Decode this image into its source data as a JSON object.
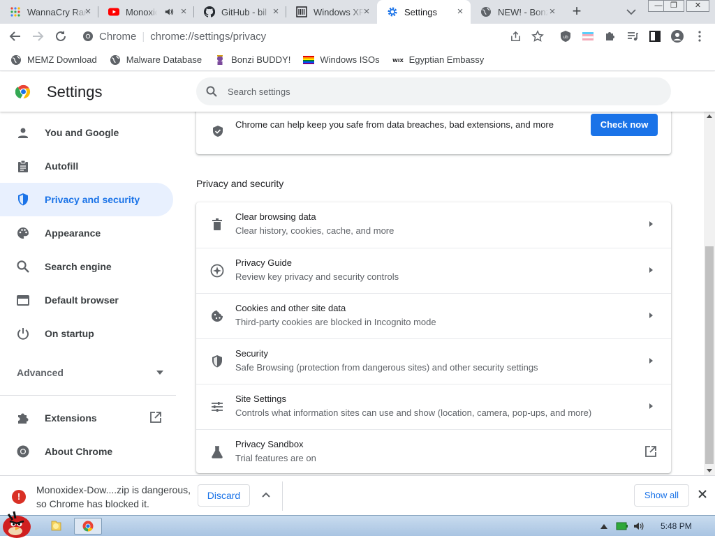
{
  "tabs": [
    {
      "title": "WannaCry Ransomware - Google Search",
      "icon": "google-apps-icon",
      "close": "×"
    },
    {
      "title": "Monoxidex - YouTube",
      "icon": "youtube-icon",
      "close": "×",
      "audio": "speaker-icon"
    },
    {
      "title": "GitHub - bil",
      "icon": "github-icon",
      "close": "×"
    },
    {
      "title": "Windows XP",
      "icon": "archive-icon",
      "close": "×"
    },
    {
      "title": "Settings",
      "icon": "settings-gear-icon",
      "close": "×",
      "active": true
    },
    {
      "title": "NEW! - Bonzi",
      "icon": "globe-icon",
      "close": "×"
    }
  ],
  "window_controls": {
    "minimize": "—",
    "maximize": "❐",
    "close": "✕"
  },
  "toolbar": {
    "site_label": "Chrome",
    "url": "chrome://settings/privacy"
  },
  "bookmarks": [
    {
      "label": "MEMZ Download",
      "icon": "globe-icon"
    },
    {
      "label": "Malware Database",
      "icon": "globe-icon"
    },
    {
      "label": "Bonzi BUDDY!",
      "icon": "bonzi-icon"
    },
    {
      "label": "Windows ISOs",
      "icon": "windows-flag-icon"
    },
    {
      "label": "Egyptian Embassy",
      "icon": "wix-icon"
    }
  ],
  "header": {
    "title": "Settings",
    "search_placeholder": "Search settings"
  },
  "sidebar": {
    "items": [
      {
        "label": "You and Google",
        "icon": "person-icon"
      },
      {
        "label": "Autofill",
        "icon": "clipboard-icon"
      },
      {
        "label": "Privacy and security",
        "icon": "shield-icon",
        "active": true
      },
      {
        "label": "Appearance",
        "icon": "palette-icon"
      },
      {
        "label": "Search engine",
        "icon": "search-icon"
      },
      {
        "label": "Default browser",
        "icon": "browser-window-icon"
      },
      {
        "label": "On startup",
        "icon": "power-icon"
      }
    ],
    "advanced_label": "Advanced",
    "extensions_label": "Extensions",
    "about_label": "About Chrome"
  },
  "safety_check": {
    "text": "Chrome can help keep you safe from data breaches, bad extensions, and more",
    "button": "Check now"
  },
  "privacy": {
    "heading": "Privacy and security",
    "rows": [
      {
        "title": "Clear browsing data",
        "subtitle": "Clear history, cookies, cache, and more",
        "icon": "trash-icon"
      },
      {
        "title": "Privacy Guide",
        "subtitle": "Review key privacy and security controls",
        "icon": "compass-icon"
      },
      {
        "title": "Cookies and other site data",
        "subtitle": "Third-party cookies are blocked in Incognito mode",
        "icon": "cookie-icon"
      },
      {
        "title": "Security",
        "subtitle": "Safe Browsing (protection from dangerous sites) and other security settings",
        "icon": "shield-icon"
      },
      {
        "title": "Site Settings",
        "subtitle": "Controls what information sites can use and show (location, camera, pop-ups, and more)",
        "icon": "sliders-icon"
      },
      {
        "title": "Privacy Sandbox",
        "subtitle": "Trial features are on",
        "icon": "flask-icon"
      }
    ]
  },
  "download_shelf": {
    "warning_icon": "!",
    "message_line1": "Monoxidex-Dow....zip is dangerous,",
    "message_line2": "so Chrome has blocked it.",
    "discard_label": "Discard",
    "show_all_label": "Show all"
  },
  "taskbar": {
    "clock": "5:48 PM"
  }
}
